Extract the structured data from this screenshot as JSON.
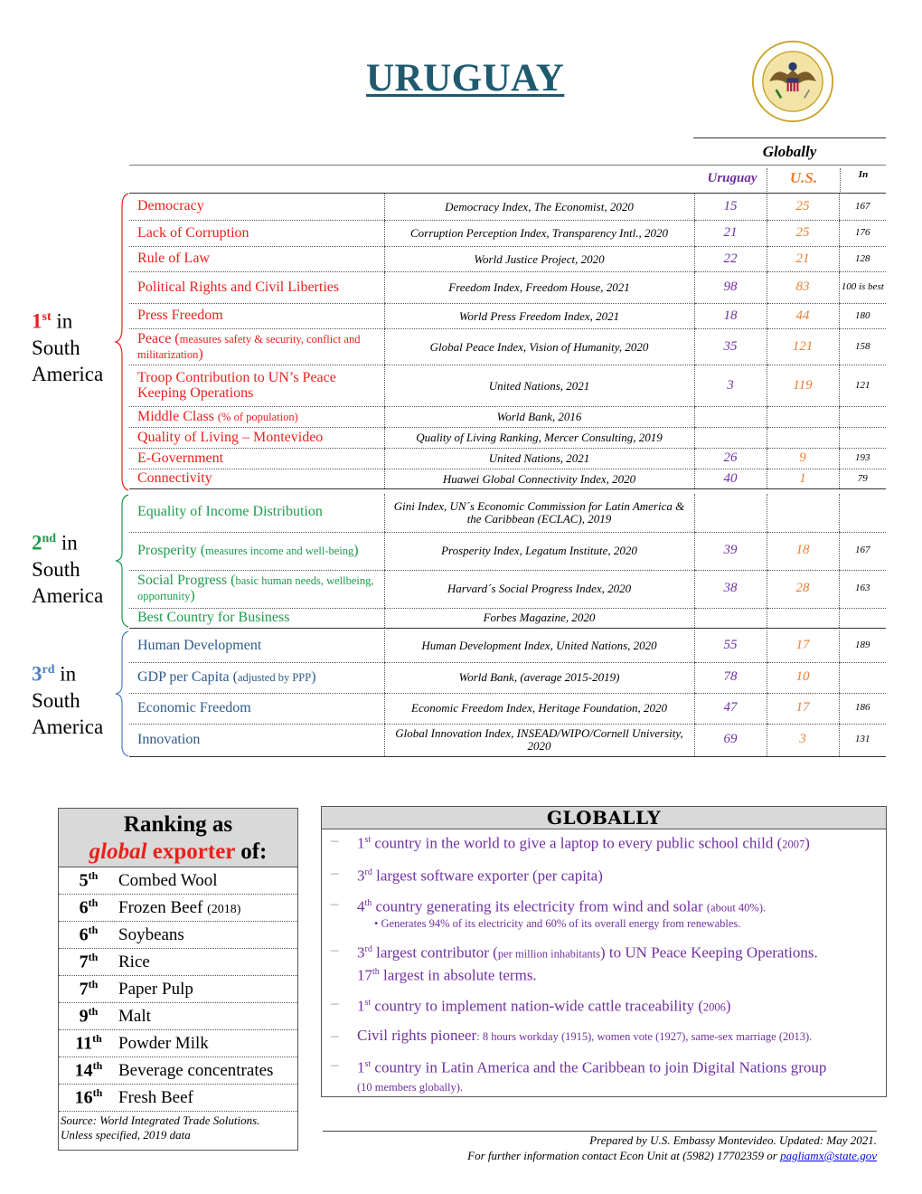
{
  "page": {
    "title": "URUGUAY",
    "seal_icon": "us-embassy-seal-icon",
    "globally_label": "Globally",
    "columns": {
      "uruguay": "Uruguay",
      "us": "U.S.",
      "in": "In"
    }
  },
  "colors": {
    "title": "#1f5a6e",
    "tier1": "#e8211c",
    "tier2": "#1e9a4c",
    "tier3": "#2e5a8a",
    "uruguay_value": "#7030a0",
    "us_value": "#ed7d31",
    "globally_text": "#7030a0"
  },
  "tiers": [
    {
      "rank": "1",
      "suffix": "st",
      "line1_rest": " in",
      "line2": "South",
      "line3": "America",
      "rows": [
        {
          "indicator": "Democracy",
          "note": "",
          "source": "Democracy Index, The Economist, 2020",
          "uruguay": "15",
          "us": "25",
          "in": "167"
        },
        {
          "indicator": "Lack of Corruption",
          "note": "",
          "source": "Corruption Perception Index, Transparency Intl., 2020",
          "uruguay": "21",
          "us": "25",
          "in": "176"
        },
        {
          "indicator": "Rule of Law",
          "note": "",
          "source": "World Justice Project, 2020",
          "uruguay": "22",
          "us": "21",
          "in": "128"
        },
        {
          "indicator": "Political Rights and Civil Liberties",
          "note": "",
          "source": "Freedom Index, Freedom House, 2021",
          "uruguay": "98",
          "us": "83",
          "in": "100 is best"
        },
        {
          "indicator": "Press Freedom",
          "note": "",
          "source": "World Press Freedom Index, 2021",
          "uruguay": "18",
          "us": "44",
          "in": "180"
        },
        {
          "indicator": "Peace (",
          "note": "measures safety & security, conflict and militarization",
          "note_close": ")",
          "source": "Global Peace Index, Vision of Humanity, 2020",
          "uruguay": "35",
          "us": "121",
          "in": "158"
        },
        {
          "indicator": "Troop Contribution to UN’s Peace Keeping Operations",
          "note": "",
          "source": "United Nations, 2021",
          "uruguay": "3",
          "us": "119",
          "in": "121"
        },
        {
          "indicator": "Middle Class ",
          "note": "(% of population)",
          "source": "World Bank, 2016",
          "uruguay": "",
          "us": "",
          "in": ""
        },
        {
          "indicator": "Quality of Living – Montevideo",
          "note": "",
          "source": "Quality of Living Ranking, Mercer Consulting, 2019",
          "uruguay": "",
          "us": "",
          "in": ""
        },
        {
          "indicator": "E-Government",
          "note": "",
          "source": "United Nations, 2021",
          "uruguay": "26",
          "us": "9",
          "in": "193"
        },
        {
          "indicator": "Connectivity",
          "note": "",
          "source": "Huawei Global Connectivity Index, 2020",
          "uruguay": "40",
          "us": "1",
          "in": "79"
        }
      ]
    },
    {
      "rank": "2",
      "suffix": "nd",
      "line1_rest": " in",
      "line2": "South",
      "line3": "America",
      "rows": [
        {
          "indicator": "Equality of Income Distribution",
          "note": "",
          "source": "Gini Index, UN´s Economic Commission for Latin America & the Caribbean (ECLAC), 2019",
          "uruguay": "",
          "us": "",
          "in": ""
        },
        {
          "indicator": "Prosperity (",
          "note": "measures income and well-being",
          "note_close": ")",
          "source": "Prosperity Index, Legatum Institute, 2020",
          "uruguay": "39",
          "us": "18",
          "in": "167"
        },
        {
          "indicator": "Social Progress (",
          "note": "basic human needs, wellbeing, opportunity",
          "note_close": ")",
          "source": "Harvard´s Social Progress Index, 2020",
          "uruguay": "38",
          "us": "28",
          "in": "163"
        },
        {
          "indicator": "Best Country for Business",
          "note": "",
          "source": "Forbes Magazine, 2020",
          "uruguay": "",
          "us": "",
          "in": ""
        }
      ]
    },
    {
      "rank": "3",
      "suffix": "rd",
      "line1_rest": " in",
      "line2": "South",
      "line3": "America",
      "rows": [
        {
          "indicator": "Human Development",
          "note": "",
          "source": "Human Development Index, United Nations, 2020",
          "uruguay": "55",
          "us": "17",
          "in": "189"
        },
        {
          "indicator": "GDP per Capita (",
          "note": "adjusted by PPP",
          "note_close": ")",
          "source": "World Bank, (average 2015-2019)",
          "uruguay": "78",
          "us": "10",
          "in": ""
        },
        {
          "indicator": "Economic Freedom",
          "note": "",
          "source": "Economic Freedom Index, Heritage Foundation, 2020",
          "uruguay": "47",
          "us": "17",
          "in": "186"
        },
        {
          "indicator": "Innovation",
          "note": "",
          "source": "Global Innovation Index, INSEAD/WIPO/Cornell University, 2020",
          "uruguay": "69",
          "us": "3",
          "in": "131"
        }
      ]
    }
  ],
  "exporter": {
    "head_line1": "Ranking as",
    "head_global": "global",
    "head_exporter": " exporter",
    "head_of": " of:",
    "items": [
      {
        "rank": "5",
        "suffix": "th",
        "product": "Combed Wool",
        "note": ""
      },
      {
        "rank": "6",
        "suffix": "th",
        "product": "Frozen Beef ",
        "note": "(2018)"
      },
      {
        "rank": "6",
        "suffix": "th",
        "product": "Soybeans",
        "note": ""
      },
      {
        "rank": "7",
        "suffix": "th",
        "product": "Rice",
        "note": ""
      },
      {
        "rank": "7",
        "suffix": "th",
        "product": "Paper Pulp",
        "note": ""
      },
      {
        "rank": "9",
        "suffix": "th",
        "product": "Malt",
        "note": ""
      },
      {
        "rank": "11",
        "suffix": "th",
        "product": "Powder Milk",
        "note": ""
      },
      {
        "rank": "14",
        "suffix": "th",
        "product": "Beverage concentrates",
        "note": ""
      },
      {
        "rank": "16",
        "suffix": "th",
        "product": "Fresh Beef",
        "note": ""
      }
    ],
    "source_line1": "Source: World Integrated Trade Solutions.",
    "source_line2": "Unless specified, 2019 data"
  },
  "globally": {
    "heading": "GLOBALLY",
    "dash": "–",
    "items": [
      {
        "n": "1",
        "sup": "st",
        "text": " country in the world to give a laptop to every public school child (",
        "small": "2007",
        "tail": ")"
      },
      {
        "n": "3",
        "sup": "rd",
        "text": " largest software exporter (per capita)",
        "small": "",
        "tail": ""
      },
      {
        "n": "4",
        "sup": "th",
        "text": " country generating its electricity from wind and solar ",
        "small": "(about 40%).",
        "tail": "",
        "sub": "• Generates 94% of its electricity and 60% of its overall energy from renewables."
      },
      {
        "n": "3",
        "sup": "rd",
        "text": " largest contributor (",
        "small": "per million inhabitants",
        "tail": ") to UN Peace Keeping Operations.",
        "line2_n": "17",
        "line2_sup": "th",
        "line2_text": " largest in absolute terms."
      },
      {
        "n": "1",
        "sup": "st",
        "text": " country to implement nation-wide cattle traceability (",
        "small": "2006",
        "tail": ")"
      },
      {
        "n": "",
        "sup": "",
        "text": "Civil rights pioneer",
        "small": ": 8 hours workday (1915), women vote (1927), same-sex marriage (2013).",
        "tail": ""
      },
      {
        "n": "1",
        "sup": "st",
        "text": " country in Latin America and the Caribbean to join Digital Nations group",
        "small": "(10 members globally).",
        "tail": ""
      }
    ]
  },
  "footer": {
    "prepared": "Prepared by U.S. Embassy Montevideo. Updated: May 2021.",
    "contact": "For further information contact Econ Unit at (5982) 17702359 or ",
    "email": "pagliamx@state.gov"
  }
}
